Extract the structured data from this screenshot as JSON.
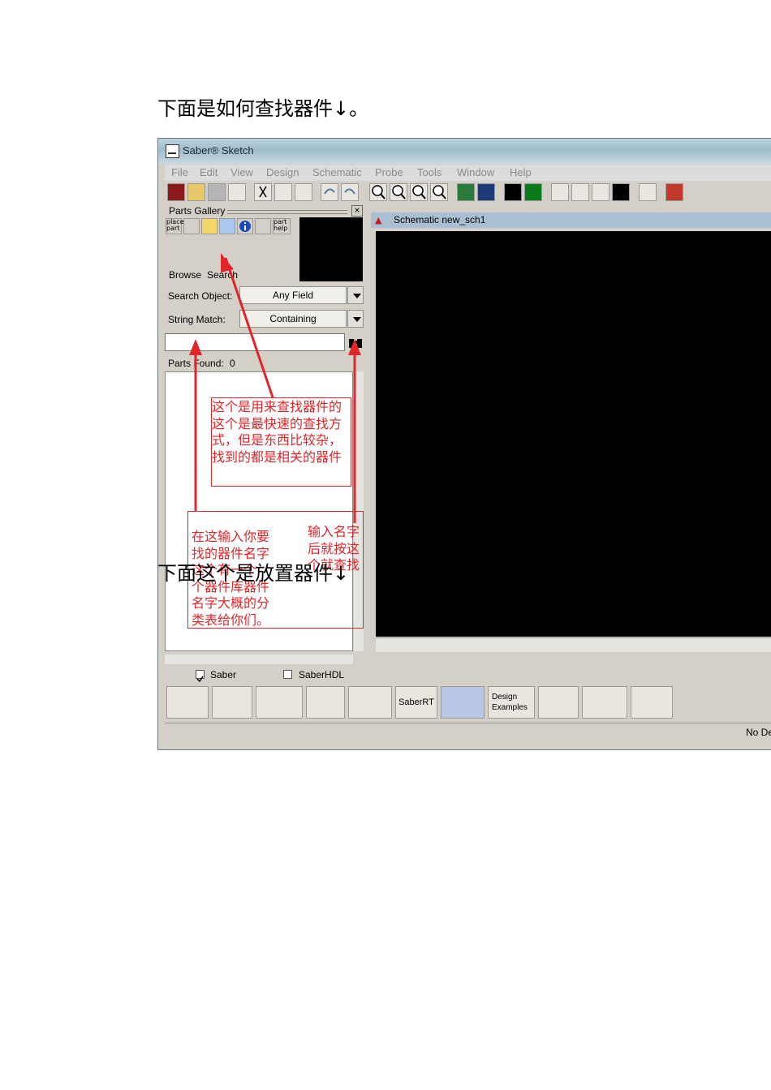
{
  "doc": {
    "heading_1": "下面是如何查找器件↓。",
    "heading_2": "下面这个是放置器件↓"
  },
  "window": {
    "title": "Saber® Sketch",
    "menu": [
      "File",
      "Edit",
      "View",
      "Design",
      "Schematic",
      "Probe",
      "Tools",
      "Window",
      "Help"
    ]
  },
  "parts_gallery": {
    "title": "Parts Gallery",
    "close_glyph": "×",
    "btn_place_part": "place part",
    "btn_part_help": "part help",
    "tab_browse": "Browse",
    "tab_search": "Search",
    "search_object_label": "Search Object:",
    "search_object_value": "Any Field",
    "string_match_label": "String Match:",
    "string_match_value": "Containing",
    "search_input_value": "",
    "parts_found_label": "Parts Found:",
    "parts_found_count": "0",
    "check_saber": "Saber",
    "check_saberhdl": "SaberHDL"
  },
  "schematic": {
    "title": "Schematic new_sch1"
  },
  "bottom_bar": {
    "saber_rt_label": "SaberRT",
    "design_examples": "Design Examples",
    "status_right": "No De"
  },
  "annotations": {
    "a1": [
      "这个是用来查找器件的",
      "这个是最快速的查找方",
      "式，但是东西比较杂，",
      "找到的都是相关的器件"
    ],
    "a2": [
      "在这输入你要",
      "找的器件名字",
      "这个有一个",
      "个器件库器件",
      "名字大概的分",
      "类表给你们。"
    ],
    "a3": [
      "输入名字",
      "后就按这",
      "个就查找"
    ]
  },
  "colors": {
    "annotation": "#e0262a",
    "canvas": "#000000",
    "window_chrome": "#d4d0c8"
  }
}
